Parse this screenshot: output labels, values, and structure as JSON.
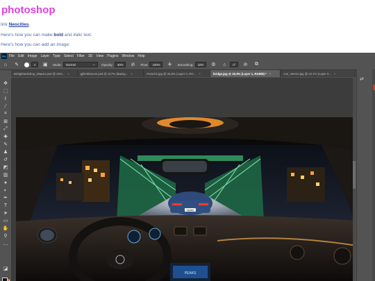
{
  "page": {
    "title": "photoshop",
    "line1": {
      "before": "link ",
      "link": "Neocities",
      "after": "."
    },
    "line2": {
      "before": "Here's how you can make ",
      "bold": "bold",
      "middle": " and ",
      "italic": "italic",
      "after": " text."
    },
    "line3": "Here's how you can add an image:"
  },
  "photoshop": {
    "logo": "Ps",
    "menu": [
      "File",
      "Edit",
      "Image",
      "Layer",
      "Type",
      "Select",
      "Filter",
      "3D",
      "View",
      "Plugins",
      "Window",
      "Help"
    ],
    "options": {
      "mode_label": "Mode:",
      "mode_value": "Normal",
      "opacity_label": "Opacity:",
      "opacity_value": "40%",
      "flow_label": "Flow:",
      "flow_value": "100%",
      "smoothing_label": "Smoothing:",
      "smoothing_value": "10%",
      "angle_value": "0°",
      "brush_size": "5"
    },
    "tabs": [
      {
        "label": "Bridgebackdrop_shapes.psd @ 25%...",
        "active": false
      },
      {
        "label": "gjihebbenom.psd @ 217% (Backg...",
        "active": false
      },
      {
        "label": "Porsche.jpg @ 25.8% (Layer 0, RG...",
        "active": false
      },
      {
        "label": "bridge.jpg @ 18.3% (Layer 1, RGB/8) *",
        "active": true
      },
      {
        "label": "Car_interior.jpg @ 22.1% (Layer 0...",
        "active": false
      }
    ],
    "tools": [
      "move-icon",
      "marquee-icon",
      "lasso-icon",
      "magic-wand-icon",
      "crop-icon",
      "frame-icon",
      "eyedropper-icon",
      "healing-brush-icon",
      "brush-icon",
      "clone-stamp-icon",
      "history-brush-icon",
      "eraser-icon",
      "gradient-icon",
      "blur-icon",
      "dodge-icon",
      "pen-icon",
      "type-icon",
      "path-select-icon",
      "rectangle-icon",
      "hand-icon",
      "zoom-icon",
      "more-tools-icon"
    ],
    "colors": {
      "foreground": "#111111",
      "background": "#c8301e",
      "accent": "#31a8ff"
    },
    "dashboard_display": "PEAKS",
    "license_plate": "PEABU"
  }
}
